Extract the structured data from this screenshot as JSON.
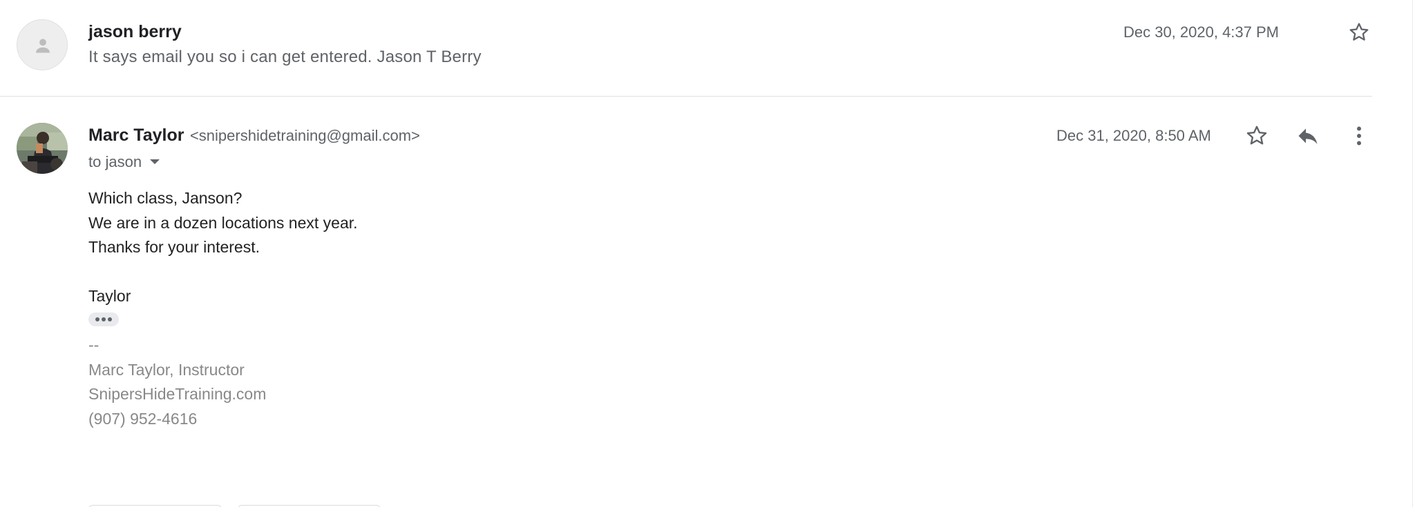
{
  "thread": {
    "messages": [
      {
        "sender_name": "jason berry",
        "snippet": "It says email you so i can get entered. Jason T Berry",
        "date": "Dec 30, 2020, 4:37 PM",
        "star_icon": "star-outline-icon",
        "avatar_icon": "person-icon"
      },
      {
        "sender_name": "Marc Taylor",
        "sender_email": "<snipershidetraining@gmail.com>",
        "to_label": "to jason",
        "date": "Dec 31, 2020, 8:50 AM",
        "star_icon": "star-outline-icon",
        "reply_icon": "reply-icon",
        "more_icon": "more-vert-icon",
        "body_lines": [
          "Which class, Janson?",
          "We are in a dozen locations next year.",
          "Thanks for your interest.",
          "",
          "Taylor"
        ],
        "signature_lines": [
          "--",
          "Marc Taylor, Instructor",
          "SnipersHideTraining.com",
          "(907) 952-4616"
        ]
      }
    ]
  },
  "colors": {
    "text_primary": "#202124",
    "text_secondary": "#5f6368",
    "signature_gray": "#888888",
    "divider": "#e0e0e0",
    "icon_gray": "#5f6368"
  }
}
